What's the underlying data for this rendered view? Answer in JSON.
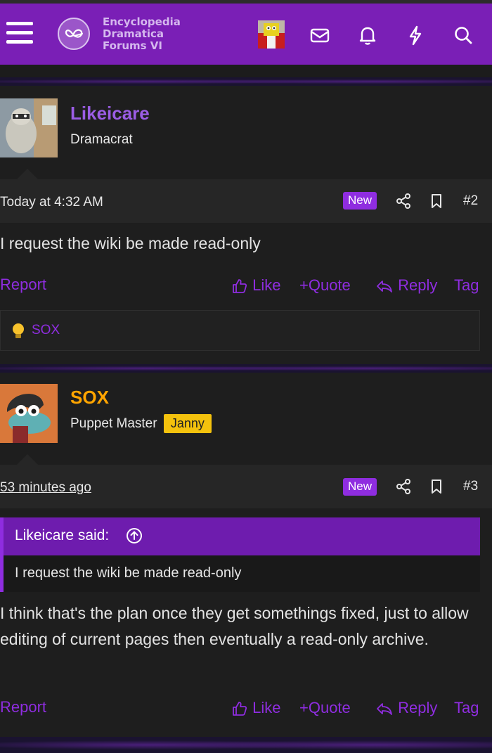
{
  "header": {
    "logo_lines": [
      "Encyclopedia",
      "Dramatica",
      "Forums VI"
    ]
  },
  "posts": [
    {
      "username": "Likeicare",
      "username_color": "#9b5de5",
      "user_title": "Dramacrat",
      "timestamp": "Today at 4:32 AM",
      "new_label": "New",
      "post_number": "#2",
      "body": "I request the wiki be made read-only",
      "actions": {
        "report": "Report",
        "like": "Like",
        "quote": "+Quote",
        "reply": "Reply",
        "tag": "Tag"
      },
      "reaction_user": "SOX"
    },
    {
      "username": "SOX",
      "username_color": "#ffa500",
      "user_title": "Puppet Master",
      "user_badge": "Janny",
      "timestamp": "53 minutes ago",
      "new_label": "New",
      "post_number": "#3",
      "quote": {
        "author_said": "Likeicare said:",
        "text": "I request the wiki be made read-only"
      },
      "body": "I think that's the plan once they get somethings fixed, just to allow editing of current pages then eventually a read-only archive.",
      "actions": {
        "report": "Report",
        "like": "Like",
        "quote": "+Quote",
        "reply": "Reply",
        "tag": "Tag"
      }
    }
  ],
  "colors": {
    "brand_purple": "#7a1fb6",
    "accent_purple": "#8f2de0",
    "janny_badge": "#f4c20d"
  }
}
